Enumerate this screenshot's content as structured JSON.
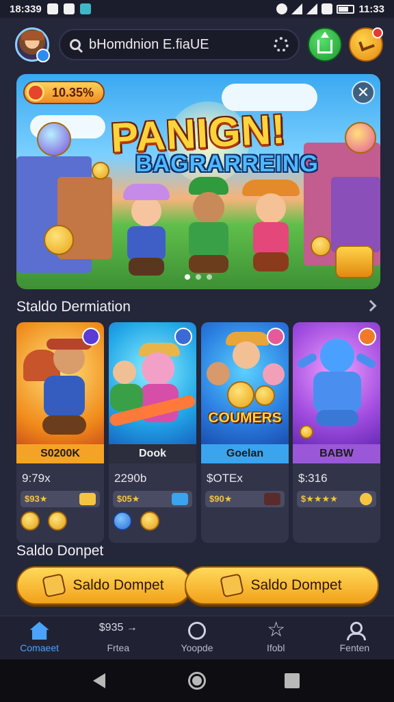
{
  "status_bar": {
    "time": "18:339",
    "clock_right": "11:33"
  },
  "header": {
    "search_placeholder": "bHomdnion E.fiaUE"
  },
  "banner": {
    "badge": "10.35%",
    "title": "PANIGN!",
    "subtitle": "BAGRARREING",
    "close": "✕",
    "slides": 3,
    "active_slide": 0
  },
  "section": {
    "title": "Staldo Dermiation"
  },
  "cards": [
    {
      "ribbon": "S0200K",
      "price": "9:79x",
      "rating": "$93★",
      "ribbon_color": "#f5a326"
    },
    {
      "ribbon": "Dook",
      "price": "2290b",
      "rating": "$05★",
      "ribbon_color": "#2c2d3d"
    },
    {
      "ribbon": "Goelan",
      "price": "$OTEx",
      "rating": "$90★",
      "ribbon_color": "#3aa4ee",
      "art_text": "COUMERS"
    },
    {
      "ribbon": "BABW",
      "price": "$:316",
      "rating": "$★★★★",
      "ribbon_color": "#9a58d8"
    }
  ],
  "wallet": {
    "label": "Saldo Donpet",
    "button_left": "Saldo Dompet",
    "button_right": "Saldo Dompet"
  },
  "bottom_nav": [
    {
      "label": "Comaeet",
      "icon": "home-icon",
      "active": true
    },
    {
      "label": "Frtea",
      "icon_text": "$935 →",
      "icon": "cash-icon"
    },
    {
      "label": "Yoopde",
      "icon": "circle-icon"
    },
    {
      "label": "Ifobl",
      "icon": "star-icon"
    },
    {
      "label": "Fenten",
      "icon": "user-icon"
    }
  ],
  "colors": {
    "background": "#24263a",
    "accent": "#4aa3ff",
    "gold": "#f2a11a"
  }
}
